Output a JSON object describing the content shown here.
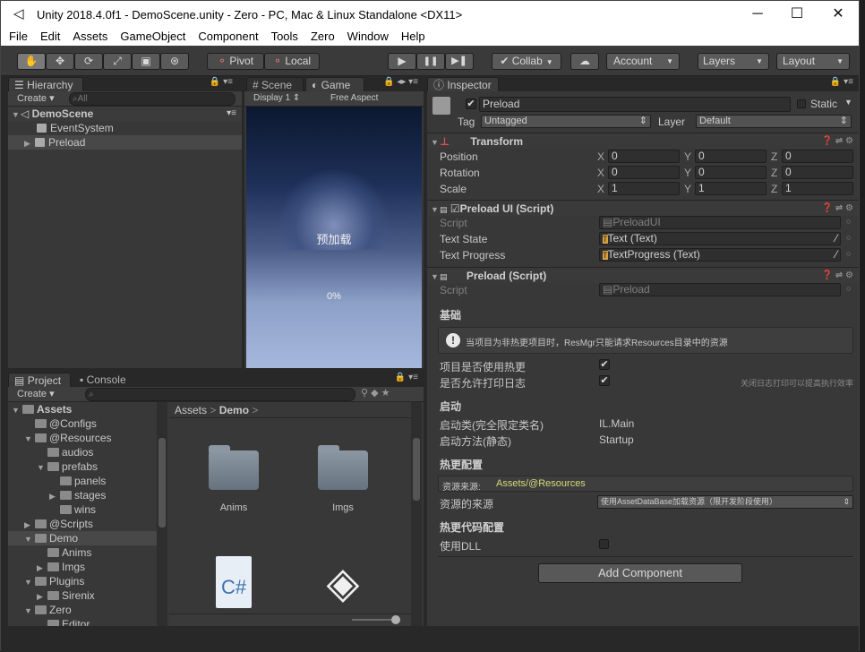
{
  "titlebar": {
    "title": "Unity 2018.4.0f1 - DemoScene.unity - Zero - PC, Mac & Linux Standalone <DX11>",
    "logo": "unity-logo",
    "minimize": "─",
    "maximize": "☐",
    "close": "✕"
  },
  "menu": [
    "File",
    "Edit",
    "Assets",
    "GameObject",
    "Component",
    "Tools",
    "Zero",
    "Window",
    "Help"
  ],
  "toolbar": {
    "pivot": "Pivot",
    "local": "Local",
    "collab": "Collab",
    "account": "Account",
    "layers": "Layers",
    "layout": "Layout",
    "play": "▶",
    "pause": "❚❚",
    "step": "▶❚",
    "tools": [
      "hand-tool",
      "move-tool",
      "rotate-tool",
      "scale-tool",
      "rect-tool",
      "transform-tool"
    ]
  },
  "hierarchy": {
    "tab": "Hierarchy",
    "create": "Create",
    "search": "All",
    "scene": "DemoScene",
    "items": [
      "EventSystem",
      "Preload"
    ]
  },
  "scene_tab": "Scene",
  "game_tab": "Game",
  "game": {
    "display": "Display 1",
    "aspect": "Free Aspect",
    "loading_text": "预加载",
    "progress": "0%"
  },
  "project": {
    "tab": "Project",
    "console_tab": "Console",
    "create": "Create",
    "breadcrumb": [
      "Assets",
      "Demo"
    ],
    "tree": [
      {
        "name": "Assets",
        "depth": 0,
        "open": true,
        "bold": true
      },
      {
        "name": "@Configs",
        "depth": 1
      },
      {
        "name": "@Resources",
        "depth": 1,
        "open": true
      },
      {
        "name": "audios",
        "depth": 2
      },
      {
        "name": "prefabs",
        "depth": 2,
        "open": true
      },
      {
        "name": "panels",
        "depth": 3
      },
      {
        "name": "stages",
        "depth": 3,
        "closed": true
      },
      {
        "name": "wins",
        "depth": 3
      },
      {
        "name": "@Scripts",
        "depth": 1,
        "closed": true
      },
      {
        "name": "Demo",
        "depth": 1,
        "open": true,
        "sel": true
      },
      {
        "name": "Anims",
        "depth": 2
      },
      {
        "name": "Imgs",
        "depth": 2,
        "closed": true
      },
      {
        "name": "Plugins",
        "depth": 1,
        "open": true
      },
      {
        "name": "Sirenix",
        "depth": 2,
        "closed": true
      },
      {
        "name": "Zero",
        "depth": 1,
        "open": true
      },
      {
        "name": "Editor",
        "depth": 2
      }
    ],
    "assets": [
      {
        "name": "Anims",
        "kind": "folder"
      },
      {
        "name": "Imgs",
        "kind": "folder"
      },
      {
        "name": "",
        "kind": "csharp",
        "label": "C#"
      },
      {
        "name": "",
        "kind": "unity"
      }
    ]
  },
  "inspector": {
    "tab": "Inspector",
    "object_name": "Preload",
    "static": "Static",
    "tag_label": "Tag",
    "tag": "Untagged",
    "layer_label": "Layer",
    "layer": "Default",
    "transform": {
      "title": "Transform",
      "rows": [
        {
          "label": "Position",
          "x": "0",
          "y": "0",
          "z": "0"
        },
        {
          "label": "Rotation",
          "x": "0",
          "y": "0",
          "z": "0"
        },
        {
          "label": "Scale",
          "x": "1",
          "y": "1",
          "z": "1"
        }
      ]
    },
    "preload_ui": {
      "title": "Preload UI (Script)",
      "script_label": "Script",
      "script": "PreloadUI",
      "text_state_label": "Text State",
      "text_state": "Text (Text)",
      "text_progress_label": "Text Progress",
      "text_progress": "TextProgress (Text)"
    },
    "preload": {
      "title": "Preload (Script)",
      "script_label": "Script",
      "script": "Preload"
    },
    "base_section": "基础",
    "info": "当项目为非热更项目时，ResMgr只能请求Resources目录中的资源",
    "use_hot": "项目是否使用热更",
    "allow_log": "是否允许打印日志",
    "log_hint": "关闭日志打印可以提高执行效率",
    "start_section": "启动",
    "start_class_label": "启动类(完全限定类名)",
    "start_class": "IL.Main",
    "start_method_label": "启动方法(静态)",
    "start_method": "Startup",
    "hot_section": "热更配置",
    "res_source_label": "资源来源:",
    "res_source": "Assets/@Resources",
    "res_from_label": "资源的来源",
    "res_from": "使用AssetDataBase加载资源（限开发阶段使用）",
    "code_section": "热更代码配置",
    "use_dll": "使用DLL",
    "add_component": "Add Component"
  },
  "colors": {
    "accent": "#3a72b0",
    "yellow": "#d8d87a"
  }
}
